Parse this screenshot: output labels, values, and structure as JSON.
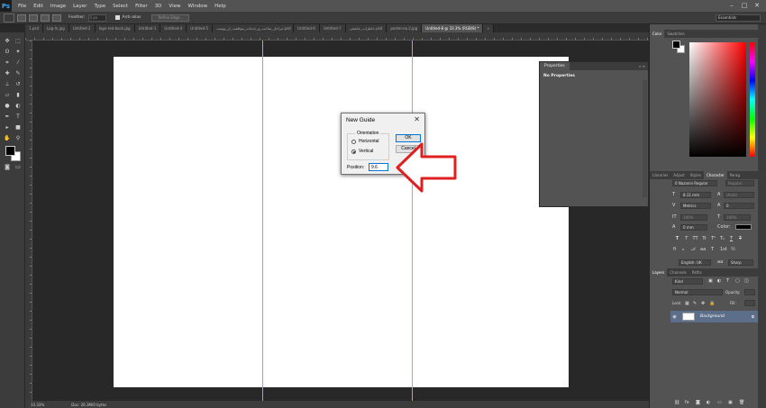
{
  "app": {
    "logo": "Ps",
    "menu": [
      "File",
      "Edit",
      "Image",
      "Layer",
      "Type",
      "Select",
      "Filter",
      "3D",
      "View",
      "Window",
      "Help"
    ],
    "window_controls": [
      "–",
      "□",
      "✕"
    ]
  },
  "options_bar": {
    "feather_label": "Feather:",
    "feather_value": "0 px",
    "anti_alias_label": "Anti-alias",
    "refine_edge_label": "Refine Edge...",
    "workspace": "Essentials"
  },
  "tabs": [
    {
      "label": "1.psd",
      "active": false
    },
    {
      "label": "Log-In.jpg",
      "active": false
    },
    {
      "label": "Untitled-2",
      "active": false
    },
    {
      "label": "logo-red-back.jpg",
      "active": false
    },
    {
      "label": "Untitled-1",
      "active": false
    },
    {
      "label": "Untitled-4",
      "active": false
    },
    {
      "label": "Untitled-5",
      "active": false
    },
    {
      "label": "مراحل_ساخت_و_خدمات_موافقت_از_پوست.psd",
      "active": false
    },
    {
      "label": "Untitled-6",
      "active": false
    },
    {
      "label": "Untitled-7",
      "active": false
    },
    {
      "label": "خاطرات_عاشقی.psd",
      "active": false
    },
    {
      "label": "poster.no.2.jpg",
      "active": false
    },
    {
      "label": "Untitled-8 @ 33.3% (RGB/8) *",
      "active": true
    },
    {
      "label": "»",
      "active": false
    }
  ],
  "status": {
    "zoom": "33.33%",
    "doc": "Doc: 26.3M/0 bytes"
  },
  "properties_panel": {
    "tab": "Properties",
    "body": "No Properties",
    "controls": "» ≡"
  },
  "color_panel": {
    "tabs": [
      "Color",
      "Swatches"
    ]
  },
  "character_panel": {
    "tabs": [
      "Libraries",
      "Adjust",
      "Styles",
      "Character",
      "Parag"
    ],
    "font_family": "0 Nazanin Regular",
    "font_style": "Regular",
    "font_size": "8.11 mm",
    "leading": "(Auto)",
    "kerning": "Metrics",
    "tracking": "0",
    "vertical_scale": "100%",
    "horizontal_scale": "100%",
    "baseline_shift": "0 mm",
    "color_label": "Color:",
    "language": "English: UK",
    "anti_alias": "Sharp",
    "type_buttons": [
      "T",
      "T",
      "TT",
      "Tr",
      "T¹",
      "T₁",
      "T",
      "T"
    ]
  },
  "layers_panel": {
    "tabs": [
      "Layers",
      "Channels",
      "Paths"
    ],
    "filter": "Kind",
    "blend_mode": "Normal",
    "opacity_label": "Opacity:",
    "lock_label": "Lock:",
    "fill_label": "Fill:",
    "layer_name": "Background"
  },
  "dialog": {
    "title": "New Guide",
    "close": "✕",
    "orientation_label": "Orientation",
    "horizontal_label": "Horizontal",
    "vertical_label": "Vertical",
    "selected": "Vertical",
    "ok_label": "OK",
    "cancel_label": "Cancel",
    "position_label": "Position:",
    "position_value": "9.6"
  },
  "colors": {
    "guide": "#3bd1e6",
    "arrow": "#e02020",
    "layer_selected": "#5c6e8a"
  }
}
